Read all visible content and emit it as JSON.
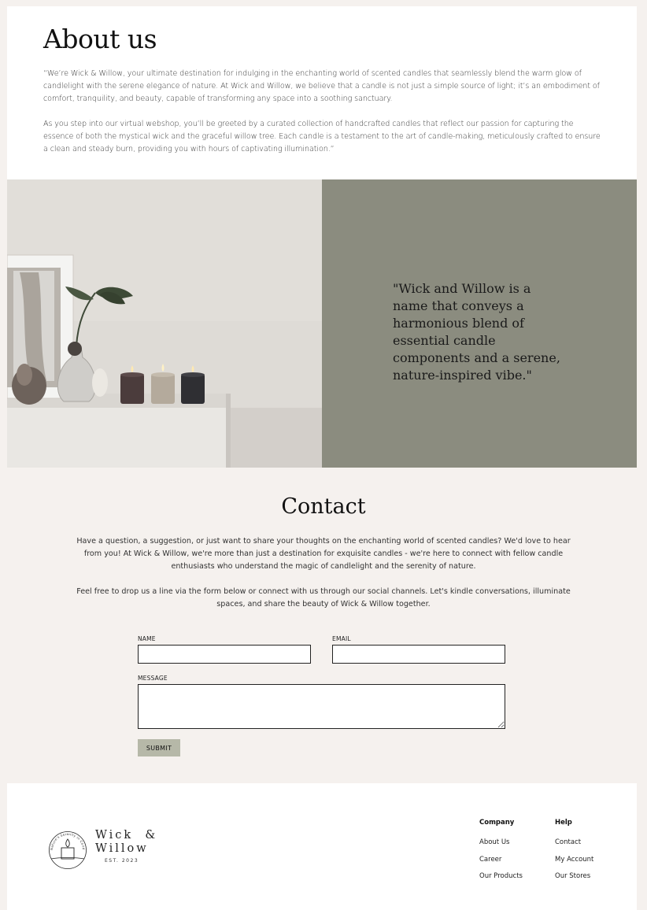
{
  "about": {
    "title": "About us",
    "paragraph1": "“We’re Wick & Willow, your ultimate destination for indulging in the enchanting world of scented candles that seamlessly blend the warm glow of candlelight with the serene elegance of nature. At Wick and Willow, we believe that a candle is not just a simple source of light; it’s an embodiment of comfort, tranquility, and beauty, capable of transforming any space into a soothing sanctuary.",
    "paragraph2": "As you step into our virtual webshop, you’ll be greeted by a curated collection of handcrafted candles that reflect our passion for capturing the essence of both the mystical wick and the graceful willow tree. Each candle is a testament to the art of candle-making, meticulously crafted to ensure a clean and steady burn, providing you with hours of captivating illumination.”"
  },
  "hero": {
    "quote": "\"Wick and Willow is a name that conveys a harmonious blend of essential candle components and a serene, nature-inspired vibe.\"",
    "quote_bg": "#8b8c7f"
  },
  "contact": {
    "title": "Contact",
    "paragraph1": "Have a question, a suggestion, or just want to share your thoughts on the enchanting world of scented candles? We'd love to hear from you! At Wick & Willow, we're more than just a destination for exquisite candles - we're here to connect with fellow candle enthusiasts who understand the magic of candlelight and the serenity of nature.",
    "paragraph2": "Feel free to drop us a line via the form below or connect with us through our social channels. Let's kindle conversations, illuminate spaces, and share the beauty of Wick & Willow together.",
    "form": {
      "name_label": "NAME",
      "name_value": "",
      "email_label": "EMAIL",
      "email_value": "",
      "message_label": "MESSAGE",
      "message_value": "",
      "submit_label": "SUBMIT"
    }
  },
  "footer": {
    "brand_line1": "Wick  &",
    "brand_line2": "Willow",
    "brand_est": "EST. 2023",
    "logo_ring_text": "Nature's Serenity in Candles",
    "company": {
      "title": "Company",
      "links": [
        "About Us",
        "Career",
        "Our Products"
      ]
    },
    "help": {
      "title": "Help",
      "links": [
        "Contact",
        "My Account",
        "Our Stores"
      ]
    }
  },
  "colors": {
    "page_bg": "#f5f1ee",
    "submit_bg": "#b6b8a8"
  }
}
